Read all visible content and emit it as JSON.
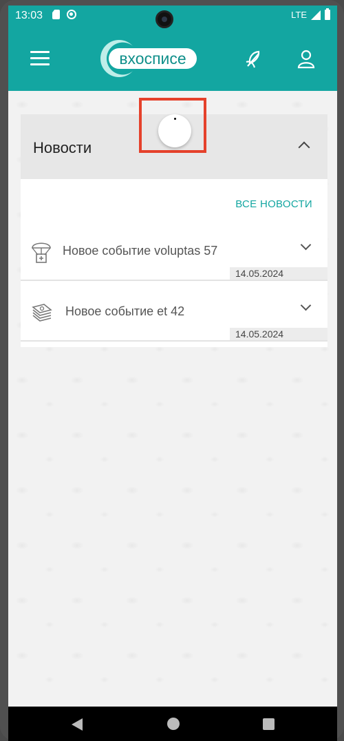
{
  "status_bar": {
    "time": "13:03",
    "network": "LTE"
  },
  "app_bar": {
    "logo_text": "вхосписе",
    "menu_icon": "menu-icon",
    "feather_icon": "feather-icon",
    "user_icon": "user-icon",
    "accent_color": "#13a6a1"
  },
  "news": {
    "title": "Новости",
    "all_news_label": "ВСЕ НОВОСТИ",
    "items": [
      {
        "icon": "aid-parachute-icon",
        "title": "Новое событие voluptas 57",
        "date": "14.05.2024"
      },
      {
        "icon": "money-stack-icon",
        "title": "Новое событие et 42",
        "date": "14.05.2024"
      }
    ]
  },
  "annotation_color": "#e5412b"
}
